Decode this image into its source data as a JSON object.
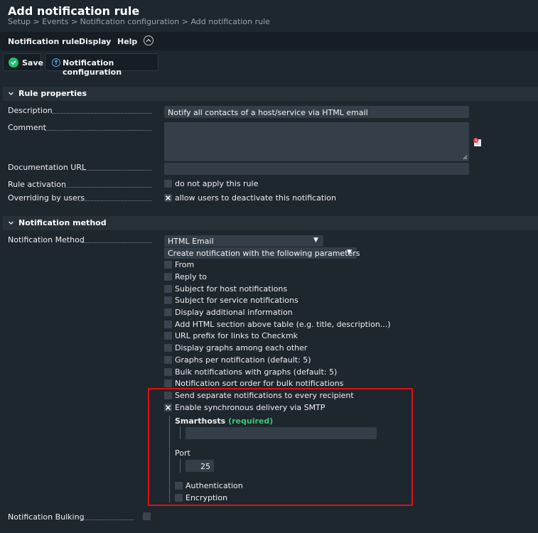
{
  "header": {
    "title": "Add notification rule",
    "breadcrumb": "Setup > Events > Notification configuration > Add notification rule"
  },
  "menu": {
    "items": [
      "Notification rule",
      "Display",
      "Help"
    ]
  },
  "toolbar": {
    "save_label": "Save",
    "config_label": "Notification configuration"
  },
  "rule_properties": {
    "heading": "Rule properties",
    "description_label": "Description",
    "description_value": "Notify all contacts of a host/service via HTML email",
    "comment_label": "Comment",
    "comment_value": "",
    "doc_url_label": "Documentation URL",
    "doc_url_value": "",
    "rule_activation_label": "Rule activation",
    "rule_activation_option": "do not apply this rule",
    "rule_activation_checked": false,
    "overriding_label": "Overriding by users",
    "overriding_option": "allow users to deactivate this notification",
    "overriding_checked": true
  },
  "notification_method": {
    "heading": "Notification method",
    "method_label": "Notification Method",
    "method_value": "HTML Email",
    "param_mode": "Create notification with the following parameters",
    "options": [
      {
        "label": "From",
        "checked": false
      },
      {
        "label": "Reply to",
        "checked": false
      },
      {
        "label": "Subject for host notifications",
        "checked": false
      },
      {
        "label": "Subject for service notifications",
        "checked": false
      },
      {
        "label": "Display additional information",
        "checked": false
      },
      {
        "label": "Add HTML section above table (e.g. title, description...)",
        "checked": false
      },
      {
        "label": "URL prefix for links to Checkmk",
        "checked": false
      },
      {
        "label": "Display graphs among each other",
        "checked": false
      },
      {
        "label": "Graphs per notification (default: 5)",
        "checked": false
      },
      {
        "label": "Bulk notifications with graphs (default: 5)",
        "checked": false
      },
      {
        "label": "Notification sort order for bulk notifications",
        "checked": false
      },
      {
        "label": "Send separate notifications to every recipient",
        "checked": false
      },
      {
        "label": "Enable synchronous delivery via SMTP",
        "checked": true
      }
    ],
    "smtp": {
      "smarthosts_label": "Smarthosts",
      "required_tag": "(required)",
      "smarthosts_value": "",
      "port_label": "Port",
      "port_value": "25",
      "authentication_label": "Authentication",
      "authentication_checked": false,
      "encryption_label": "Encryption",
      "encryption_checked": false
    },
    "bulking_label": "Notification Bulking",
    "bulking_checked": false
  },
  "colors": {
    "background": "#1e262e",
    "accent_green": "#1fbf6c",
    "required_green": "#3bc47a",
    "highlight_red": "#e01010"
  }
}
